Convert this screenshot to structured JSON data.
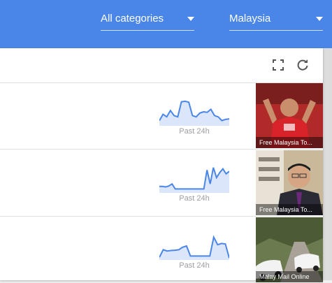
{
  "filters": {
    "category": "All categories",
    "country": "Malaysia"
  },
  "toolbar": {
    "fullscreen_icon": "fullscreen-icon",
    "refresh_icon": "refresh-icon"
  },
  "rows": [
    {
      "range_label": "Past 24h",
      "thumb_caption": "Free Malaysia To...",
      "spark": [
        0.15,
        0.4,
        0.3,
        0.55,
        0.35,
        0.3,
        0.9,
        0.92,
        0.88,
        0.35,
        0.3,
        0.45,
        0.5,
        0.48,
        0.6,
        0.35,
        0.3,
        0.15,
        0.2,
        0.22
      ]
    },
    {
      "range_label": "Past 24h",
      "thumb_caption": "Free Malaysia To...",
      "spark": [
        0.2,
        0.2,
        0.18,
        0.22,
        0.3,
        0.1,
        0.1,
        0.1,
        0.1,
        0.1,
        0.1,
        0.1,
        0.1,
        0.1,
        0.1,
        0.85,
        0.3,
        0.95,
        0.55,
        0.75,
        0.9,
        0.7,
        0.8
      ]
    },
    {
      "range_label": "Past 24h",
      "thumb_caption": "Malay Mail Online",
      "spark": [
        0.05,
        0.35,
        0.3,
        0.32,
        0.33,
        0.35,
        0.45,
        0.5,
        0.1,
        0.1,
        0.1,
        0.1,
        0.1,
        0.1,
        0.85,
        0.55,
        0.6,
        0.58,
        0.02
      ]
    }
  ],
  "colors": {
    "header": "#4a86e8",
    "spark_line": "#4a86e8",
    "spark_fill": "#dbe6fb"
  }
}
